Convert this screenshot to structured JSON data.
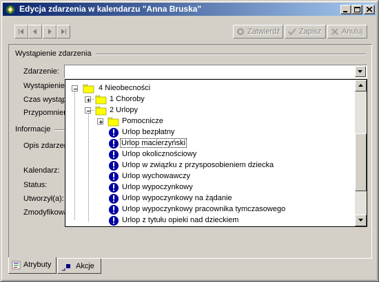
{
  "window": {
    "title": "Edycja zdarzenia w kalendarzu \"Anna Bruska\""
  },
  "toolbar": {
    "confirm_label": "Zatwierdź",
    "save_label": "Zapisz",
    "cancel_label": "Anuluj"
  },
  "section_occurrence": {
    "title": "Wystąpienie zdarzenia",
    "event_label": "Zdarzenie:",
    "event_value": "",
    "occurrence_label": "Wystąpienie",
    "duration_label": "Czas wystąp",
    "reminder_label": "Przypomnien"
  },
  "section_info": {
    "title": "Informacje",
    "description_label": "Opis zdarzen",
    "calendar_label": "Kalendarz:",
    "status_label": "Status:",
    "created_by_label": "Utworzył(a):",
    "modified_by_label": "Zmodyfikowa"
  },
  "tree": {
    "items": [
      {
        "label": "4 Nieobecności",
        "type": "folder",
        "level": 0,
        "expander": "minus"
      },
      {
        "label": "1 Choroby",
        "type": "folder",
        "level": 1,
        "expander": "plus"
      },
      {
        "label": "2 Urlopy",
        "type": "folder",
        "level": 1,
        "expander": "minus"
      },
      {
        "label": "Pomocnicze",
        "type": "folder",
        "level": 2,
        "expander": "plus"
      },
      {
        "label": "Urlop bezpłatny",
        "type": "item",
        "level": 2
      },
      {
        "label": "Urlop macierzyński",
        "type": "item",
        "level": 2,
        "selected": true
      },
      {
        "label": "Urlop okolicznościowy",
        "type": "item",
        "level": 2
      },
      {
        "label": "Urlop w związku z przysposobieniem dziecka",
        "type": "item",
        "level": 2
      },
      {
        "label": "Urlop wychowawczy",
        "type": "item",
        "level": 2
      },
      {
        "label": "Urlop wypoczynkowy",
        "type": "item",
        "level": 2
      },
      {
        "label": "Urlop wypoczynkowy na żądanie",
        "type": "item",
        "level": 2
      },
      {
        "label": "Urlop wypoczynkowy pracownika tymczasowego",
        "type": "item",
        "level": 2
      },
      {
        "label": "Urlop z tytułu opieki nad dzieckiem",
        "type": "item",
        "level": 2
      }
    ]
  },
  "tabs": [
    {
      "label": "Atrybuty",
      "active": true
    },
    {
      "label": "Akcje",
      "active": false
    }
  ],
  "colors": {
    "titlebar_start": "#0a246a",
    "titlebar_end": "#a6caf0",
    "face": "#d4d0c8",
    "info_icon": "#0000a0"
  },
  "icons": [
    "app-icon",
    "minimize-icon",
    "maximize-icon",
    "close-icon",
    "first-record-icon",
    "prev-record-icon",
    "next-record-icon",
    "last-record-icon",
    "confirm-icon",
    "save-icon",
    "cancel-icon",
    "folder-icon",
    "info-icon",
    "attributes-tab-icon",
    "actions-tab-icon"
  ]
}
